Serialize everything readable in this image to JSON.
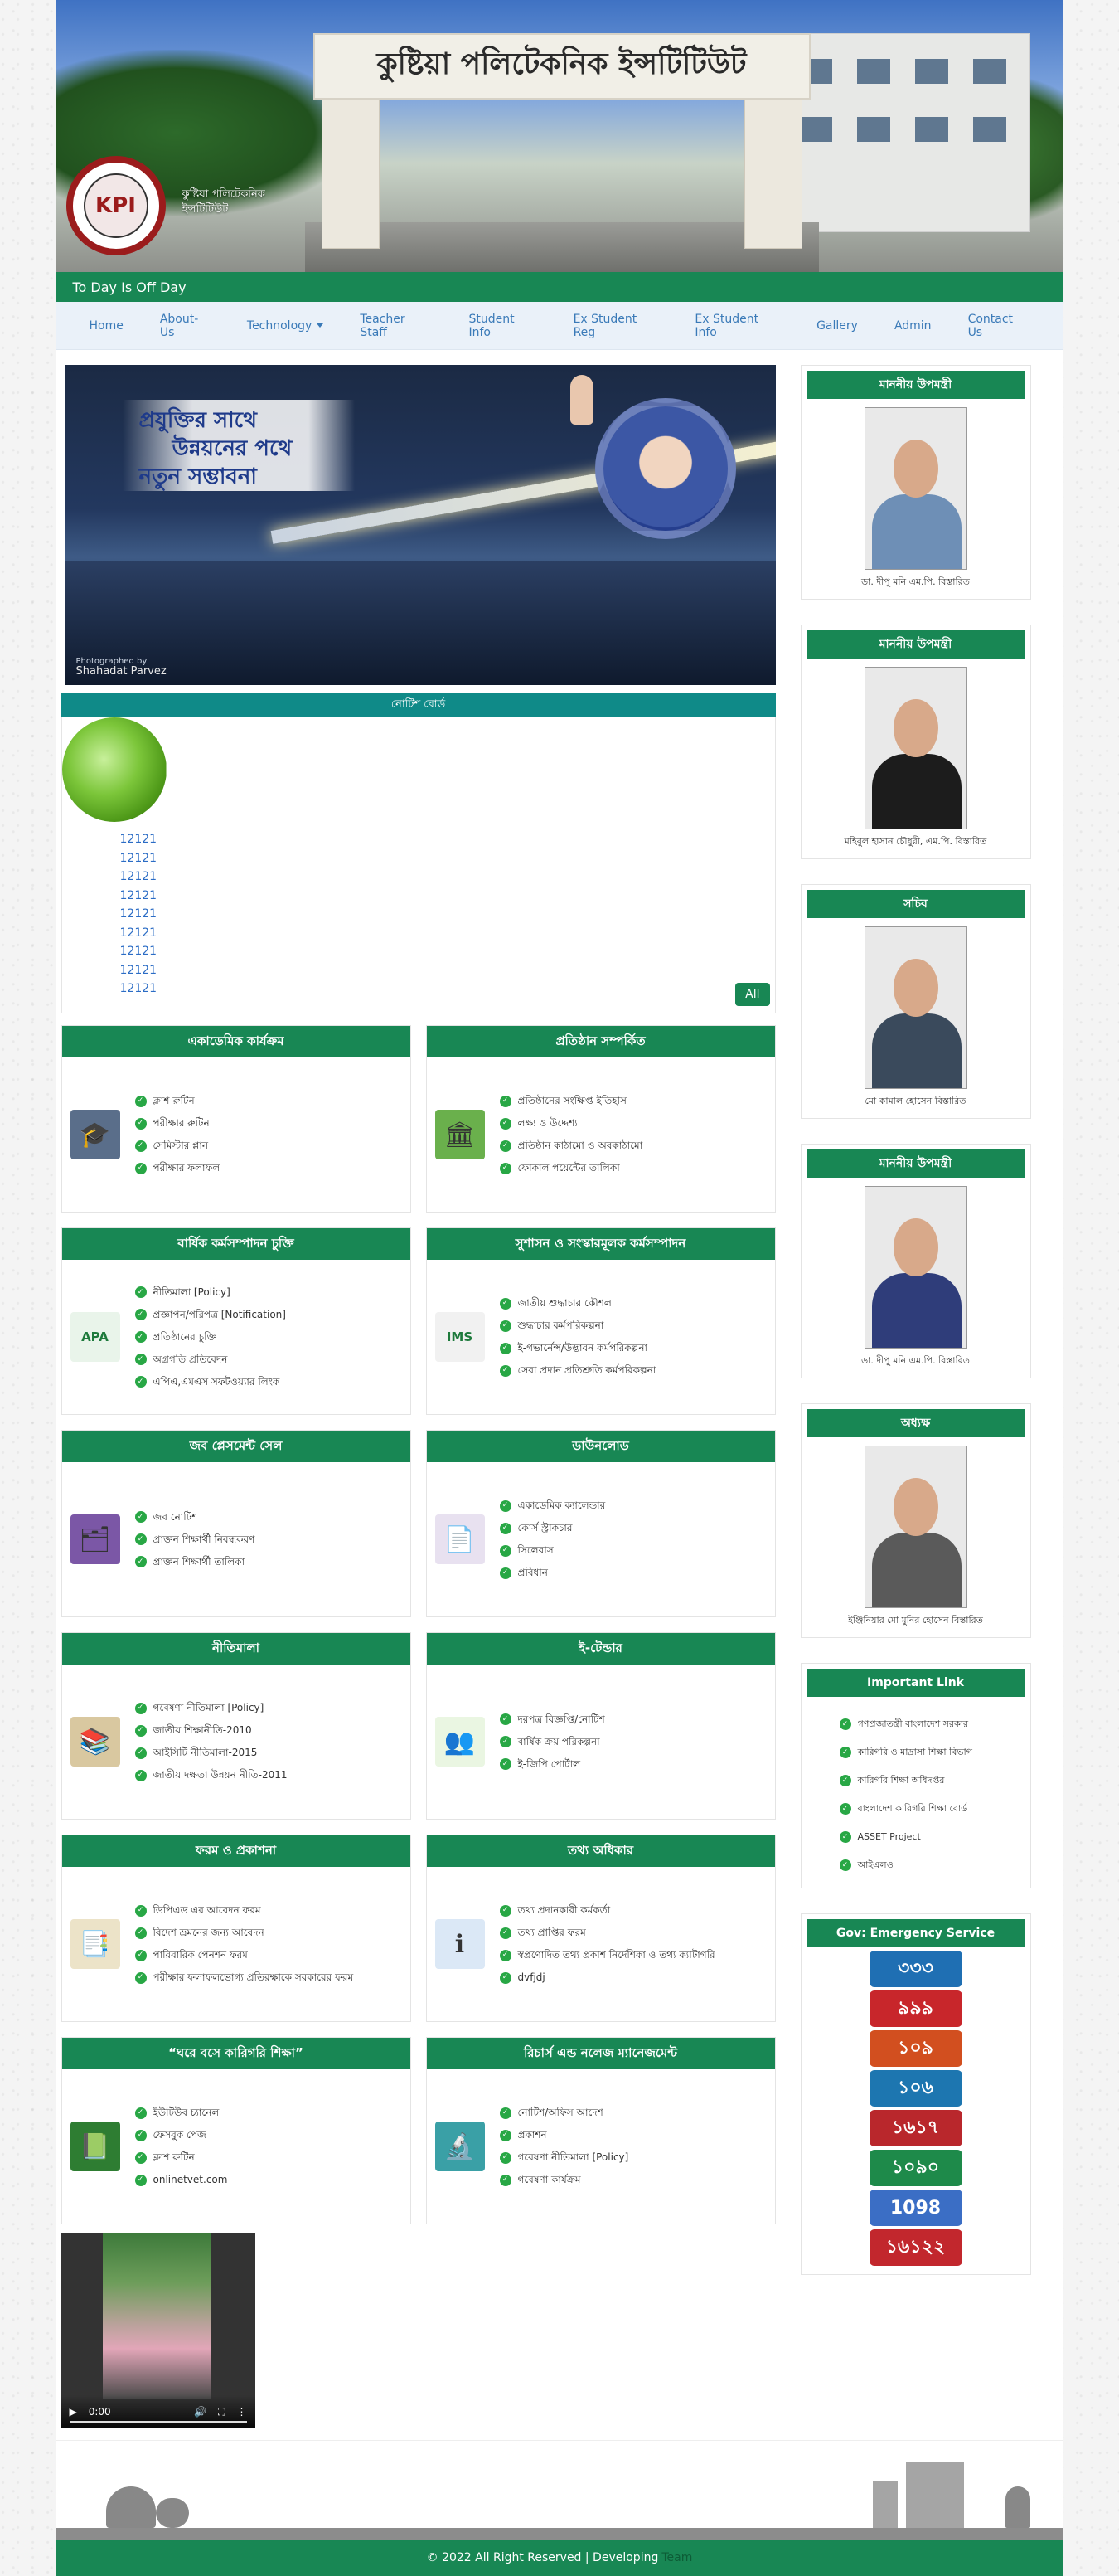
{
  "header": {
    "banner_text": "কুষ্টিয়া পলিটেকনিক ইন্সটিটিউট",
    "logo_text": "Kushtia Polytechnic Institute • Kushtia",
    "banner_sub": [
      "কুষ্টিয়া পলিটেকনিক",
      "ইন্সটিটিউট"
    ],
    "offday": "To Day Is Off Day"
  },
  "nav": {
    "items": [
      "Home",
      "About-Us",
      "Technology",
      "Teacher Staff",
      "Student Info",
      "Ex Student Reg",
      "Ex Student Info",
      "Gallery",
      "Admin",
      "Contact Us"
    ]
  },
  "hero": {
    "lines": [
      "প্রযুক্তির সাথে",
      "উন্নয়নের পথে",
      "নতুন সম্ভাবনা"
    ],
    "credit": [
      "Photographed by",
      "Shahadat Parvez"
    ]
  },
  "notice": {
    "title": "নোটিশ বোর্ড",
    "items": [
      "12121",
      "12121",
      "12121",
      "12121",
      "12121",
      "12121",
      "12121",
      "12121",
      "12121"
    ],
    "all_label": "All"
  },
  "sections": [
    {
      "title": "একাডেমিক কার্যক্রম",
      "icon": "graduation-cap-icon",
      "glyph": "🎓",
      "items": [
        "ক্লাশ রুটিন",
        "পরীক্ষার রুটিন",
        "সেমিস্টার প্লান",
        "পরীক্ষার ফলাফল"
      ]
    },
    {
      "title": "প্রতিষ্ঠান সম্পর্কিত",
      "icon": "institution-icon",
      "glyph": "🏛",
      "items": [
        "প্রতিষ্ঠানের সংক্ষিপ্ত ইতিহাস",
        "লক্ষ্য ও উদ্দেশ্য",
        "প্রতিষ্ঠান কাঠামো ও অবকাঠামো",
        "ফোকাল পয়েন্টের তালিকা"
      ]
    },
    {
      "title": "বার্ষিক কর্মসম্পাদন চুক্তি",
      "icon": "apa-icon",
      "glyph": "APA",
      "items": [
        "নীতিমালা [Policy]",
        "প্রজ্ঞাপন/পরিপত্র [Notification]",
        "প্রতিষ্ঠানের চুক্তি",
        "অগ্রগতি প্রতিবেদন",
        "এপিএ,এমএস সফটওয়্যার লিংক"
      ]
    },
    {
      "title": "সুশাসন ও সংস্কারমূলক কর্মসম্পাদন",
      "icon": "ims-icon",
      "glyph": "IMS",
      "items": [
        "জাতীয় শুদ্ধাচার কৌশল",
        "শুদ্ধাচার কর্মপরিকল্পনা",
        "ই-গভার্নেন্স/উদ্ভাবন কর্মপরিকল্পনা",
        "সেবা প্রদান প্রতিশ্রুতি কর্মপরিকল্পনা"
      ]
    },
    {
      "title": "জব প্লেসমেন্ট সেল",
      "icon": "job-board-icon",
      "glyph": "🗂",
      "items": [
        "জব নোটিশ",
        "প্রাক্তন শিক্ষার্থী নিবন্ধকরণ",
        "প্রাক্তন শিক্ষার্থী তালিকা"
      ]
    },
    {
      "title": "ডাউনলোড",
      "icon": "download-icon",
      "glyph": "📄",
      "items": [
        "একাডেমিক ক্যালেন্ডার",
        "কোর্স স্ট্রাকচার",
        "সিলেবাস",
        "প্রবিধান"
      ]
    },
    {
      "title": "নীতিমালা",
      "icon": "books-icon",
      "glyph": "📚",
      "items": [
        "গবেষণা নীতিমালা [Policy]",
        "জাতীয় শিক্ষানীতি-2010",
        "আইসিটি নীতিমালা-2015",
        "জাতীয় দক্ষতা উন্নয়ন নীতি-2011"
      ]
    },
    {
      "title": "ই-টেন্ডার",
      "icon": "tender-icon",
      "glyph": "👥",
      "items": [
        "দরপত্র বিজ্ঞপ্তি/নোটিশ",
        "বার্ষিক ক্রয় পরিকল্পনা",
        "ই-জিপি পোর্টাল"
      ]
    },
    {
      "title": "ফরম ও প্রকাশনা",
      "icon": "forms-icon",
      "glyph": "📑",
      "items": [
        "ডিপিএড এর আবেদন ফরম",
        "বিদেশ ভ্রমনের জন্য আবেদন",
        "পারিবারিক পেনশন ফরম",
        "পরীক্ষার ফলাফলভোগ্য প্রতিরক্ষাকে সরকারের ফরম"
      ]
    },
    {
      "title": "তথ্য অধিকার",
      "icon": "right-to-information-icon",
      "glyph": "ℹ",
      "items": [
        "তথ্য প্রদানকারী কর্মকর্তা",
        "তথ্য প্রাপ্তির ফরম",
        "স্বপ্রণোদিত তথ্য প্রকাশ নির্দেশিকা ও তথ্য ক্যাটাগরি",
        "dvfjdj"
      ]
    },
    {
      "title": "“ঘরে বসে কারিগরি শিক্ষা”",
      "icon": "online-education-icon",
      "glyph": "📗",
      "items": [
        "ইউটিউব চ্যানেল",
        "ফেসবুক পেজ",
        "ক্লাশ রুটিন",
        "onlinetvet.com"
      ]
    },
    {
      "title": "রিচার্স এন্ড নলেজ ম্যানেজমেন্ট",
      "icon": "research-icon",
      "glyph": "🔬",
      "items": [
        "নোটিশ/অফিস আদেশ",
        "প্রকাশন",
        "গবেষণা নীতিমালা [Policy]",
        "গবেষণা কার্যক্রম"
      ]
    }
  ],
  "video": {
    "time": "0:00"
  },
  "sidebar": {
    "officials": [
      {
        "title": "মাননীয় উপমন্ত্রী",
        "caption": "ডা. দীপু মনি এম.পি. বিস্তারিত",
        "body": "#6e8fb6"
      },
      {
        "title": "মাননীয় উপমন্ত্রী",
        "caption": "মহিবুল হাসান চৌধুরী, এম.পি. বিস্তারিত",
        "body": "#1c1c1c"
      },
      {
        "title": "সচিব",
        "caption": "মো কামাল হোসেন বিস্তারিত",
        "body": "#3a4a5c"
      },
      {
        "title": "মাননীয় উপমন্ত্রী",
        "caption": "ডা. দীপু মনি এম.পি. বিস্তারিত",
        "body": "#2f3d7a"
      },
      {
        "title": "অধ্যক্ষ",
        "caption": "ইঞ্জিনিয়ার মো মুনির হোসেন বিস্তারিত",
        "body": "#5a5a5a"
      }
    ],
    "important_title": "Important Link",
    "important_links": [
      "গণপ্রজাতন্ত্রী বাংলাদেশ সরকার",
      "কারিগরি ও মাদ্রাসা শিক্ষা বিভাগ",
      "কারিগরি শিক্ষা অধিদপ্তর",
      "বাংলাদেশ কারিগরি শিক্ষা বোর্ড",
      "ASSET Project",
      "আইএলও"
    ],
    "emergency_title": "Gov: Emergency Service",
    "emergency": [
      {
        "label": "৩৩৩",
        "color": "#1f6fb3"
      },
      {
        "label": "৯৯৯",
        "color": "#c8262b"
      },
      {
        "label": "১০৯",
        "color": "#d24f1f"
      },
      {
        "label": "১০৬",
        "color": "#1d76b0"
      },
      {
        "label": "১৬১৭",
        "color": "#b9272c"
      },
      {
        "label": "১০৯০",
        "color": "#1e8a4a"
      },
      {
        "label": "1098",
        "color": "#3b6ec5"
      },
      {
        "label": "১৬১২২",
        "color": "#c2272d"
      }
    ]
  },
  "footer": {
    "copyright": "© 2022 All Right Reserved | Developing",
    "dev": "Team"
  }
}
